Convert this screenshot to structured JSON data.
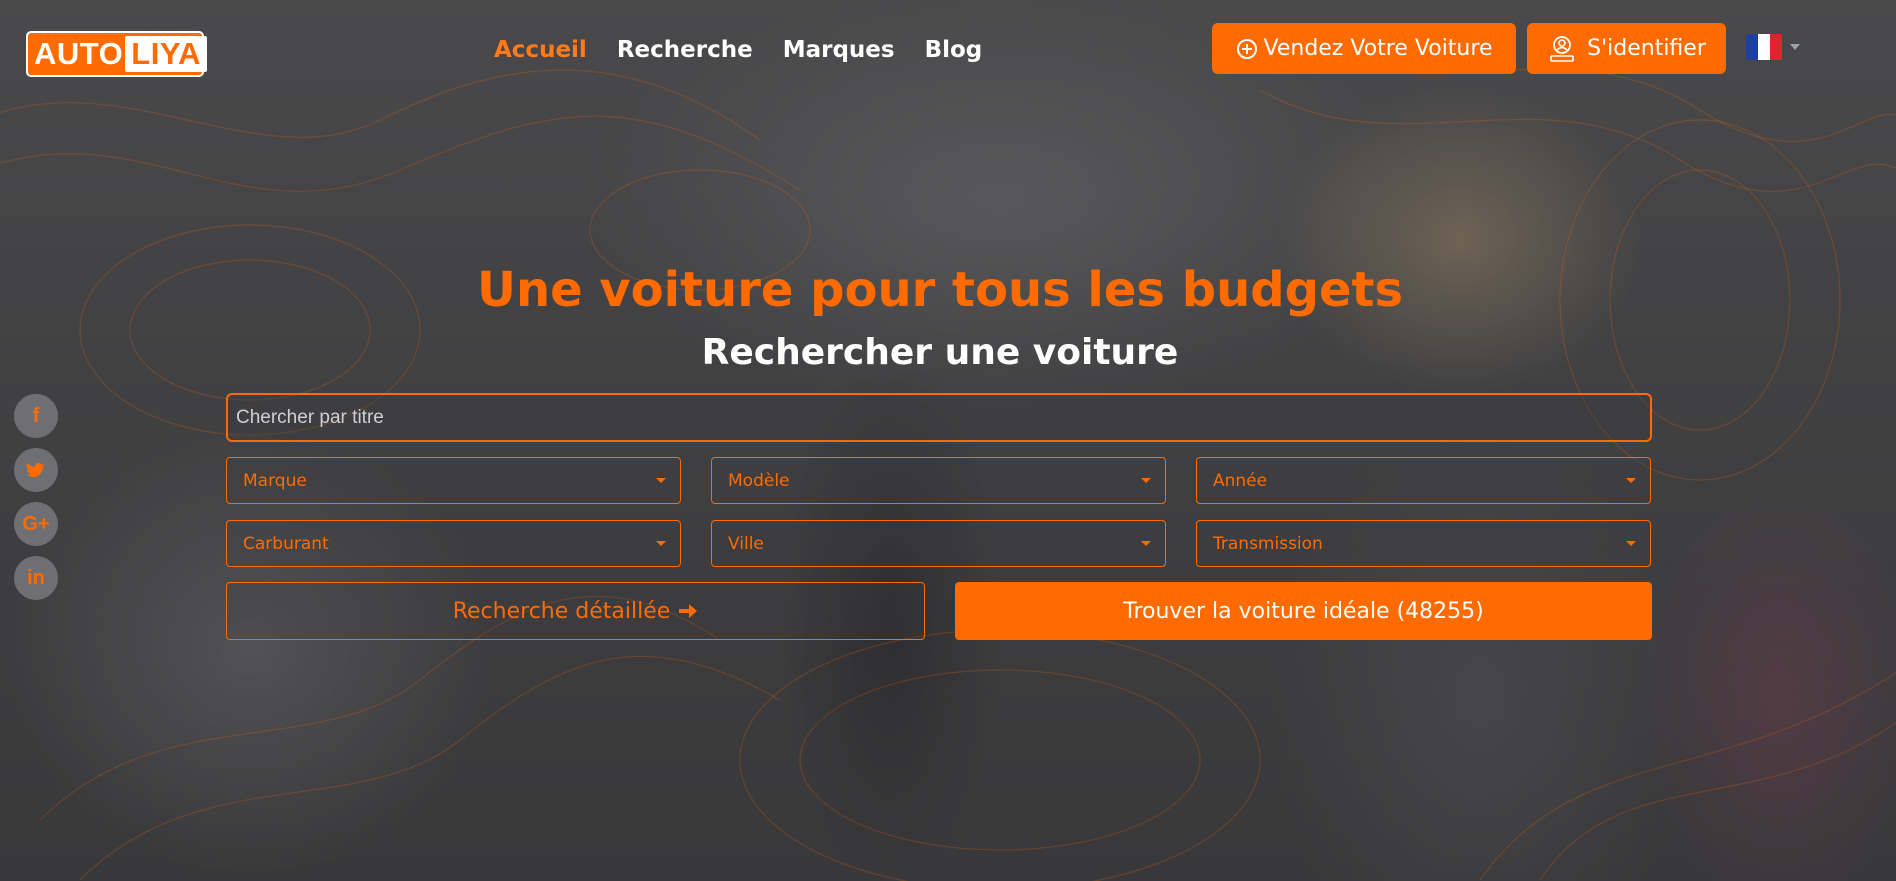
{
  "brand": {
    "logo_part1": "AUTO",
    "logo_part2": "LIYA",
    "accent": "#ff6b00"
  },
  "nav": [
    {
      "label": "Accueil",
      "active": true
    },
    {
      "label": "Recherche",
      "active": false
    },
    {
      "label": "Marques",
      "active": false
    },
    {
      "label": "Blog",
      "active": false
    }
  ],
  "header": {
    "sell_label": "Vendez Votre Voiture",
    "sell_icon": "plus-circle-icon",
    "login_label": "S'identifier",
    "login_icon": "user-icon",
    "language_flag": "france-flag"
  },
  "social": [
    {
      "icon": "facebook-icon",
      "glyph": "f"
    },
    {
      "icon": "twitter-icon",
      "glyph": "t"
    },
    {
      "icon": "google-plus-icon",
      "glyph": "G+"
    },
    {
      "icon": "linkedin-icon",
      "glyph": "in"
    }
  ],
  "hero": {
    "title": "Une voiture pour tous les budgets",
    "subtitle": "Rechercher une voiture"
  },
  "search": {
    "placeholder": "Chercher par titre",
    "filters": [
      "Marque",
      "Modèle",
      "Année",
      "Carburant",
      "Ville",
      "Transmission"
    ],
    "detail_label": "Recherche détaillée",
    "find_label": "Trouver la voiture idéale (48255)"
  }
}
